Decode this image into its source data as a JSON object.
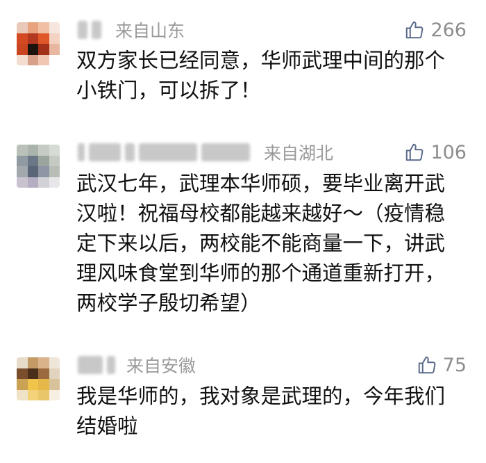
{
  "comments": [
    {
      "location": "来自山东",
      "likes": "266",
      "text": "双方家长已经同意，华师武理中间的那个小铁门，可以拆了！"
    },
    {
      "location": "来自湖北",
      "likes": "106",
      "text": "武汉七年，武理本华师硕，要毕业离开武汉啦！祝福母校都能越来越好～（疫情稳定下来以后，两校能不能商量一下，讲武理风味食堂到华师的那个通道重新打开，两校学子殷切希望）"
    },
    {
      "location": "来自安徽",
      "likes": "75",
      "text": "我是华师的，我对象是武理的，今年我们结婚啦"
    }
  ],
  "icons": {
    "like": "thumbs-up-icon"
  },
  "colors": {
    "meta": "#9a9a9a",
    "text": "#111111"
  }
}
